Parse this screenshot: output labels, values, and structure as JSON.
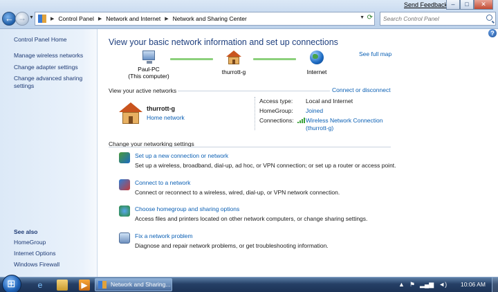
{
  "window": {
    "feedback_label": "Send Feedback",
    "minimize_glyph": "–",
    "maximize_glyph": "□",
    "close_glyph": "✕"
  },
  "address_bar": {
    "breadcrumbs": [
      "Control Panel",
      "Network and Internet",
      "Network and Sharing Center"
    ]
  },
  "search": {
    "placeholder": "Search Control Panel"
  },
  "sidebar": {
    "home": "Control Panel Home",
    "links": [
      "Manage wireless networks",
      "Change adapter settings",
      "Change advanced sharing settings"
    ],
    "see_also_title": "See also",
    "see_also": [
      "HomeGroup",
      "Internet Options",
      "Windows Firewall"
    ]
  },
  "main": {
    "headline": "View your basic network information and set up connections",
    "see_full_map": "See full map",
    "map": {
      "pc_name": "Paul-PC",
      "pc_sub": "(This computer)",
      "network": "thurrott-g",
      "internet": "Internet"
    },
    "active_networks_label": "View your active networks",
    "connect_disconnect": "Connect or disconnect",
    "active_network": {
      "name": "thurrott-g",
      "type": "Home network",
      "access_type_label": "Access type:",
      "access_type": "Local and Internet",
      "homegroup_label": "HomeGroup:",
      "homegroup": "Joined",
      "connections_label": "Connections:",
      "connection_line1": "Wireless Network Connection",
      "connection_line2": "(thurrott-g)"
    },
    "change_settings_label": "Change your networking settings",
    "tasks": [
      {
        "title": "Set up a new connection or network",
        "desc": "Set up a wireless, broadband, dial-up, ad hoc, or VPN connection; or set up a router or access point.",
        "icon": "new-connection-icon"
      },
      {
        "title": "Connect to a network",
        "desc": "Connect or reconnect to a wireless, wired, dial-up, or VPN network connection.",
        "icon": "connect-network-icon"
      },
      {
        "title": "Choose homegroup and sharing options",
        "desc": "Access files and printers located on other network computers, or change sharing settings.",
        "icon": "homegroup-icon"
      },
      {
        "title": "Fix a network problem",
        "desc": "Diagnose and repair network problems, or get troubleshooting information.",
        "icon": "troubleshoot-icon"
      }
    ]
  },
  "taskbar": {
    "active_task": "Network and Sharing...",
    "clock": "10:06 AM"
  },
  "colors": {
    "link": "#0a5fb4",
    "headline": "#1e3f7e",
    "connector": "#8cd07c"
  }
}
